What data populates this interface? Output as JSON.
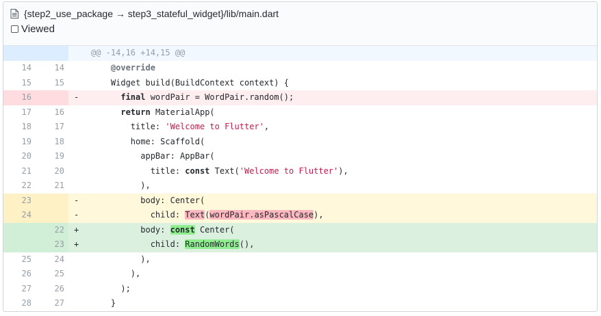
{
  "file_header": {
    "path": "{step2_use_package → step3_stateful_widget}/lib/main.dart",
    "viewed_label": "Viewed",
    "icon": "file-icon"
  },
  "hunk": {
    "header": "@@ -14,16 +14,15 @@"
  },
  "colors": {
    "deletion": "#ffeef0",
    "addition": "#e6ffed",
    "modified_old": "#fff8db",
    "modified_new": "#dbf0df",
    "string": "#c41a4c"
  },
  "lines": [
    {
      "old": "14",
      "new": "14",
      "sign": "",
      "parts": [
        [
          "    ",
          ""
        ],
        [
          "@override",
          "ann"
        ]
      ]
    },
    {
      "old": "15",
      "new": "15",
      "sign": "",
      "parts": [
        [
          "    Widget build(BuildContext context) {",
          ""
        ]
      ]
    },
    {
      "old": "16",
      "new": "",
      "sign": "-",
      "parts": [
        [
          "      ",
          ""
        ],
        [
          "final",
          "kw"
        ],
        [
          " wordPair = WordPair.random();",
          ""
        ]
      ]
    },
    {
      "old": "17",
      "new": "16",
      "sign": "",
      "parts": [
        [
          "      ",
          ""
        ],
        [
          "return",
          "kw"
        ],
        [
          " MaterialApp(",
          ""
        ]
      ]
    },
    {
      "old": "18",
      "new": "17",
      "sign": "",
      "parts": [
        [
          "        title: ",
          ""
        ],
        [
          "'Welcome to Flutter'",
          "str"
        ],
        [
          ",",
          ""
        ]
      ]
    },
    {
      "old": "19",
      "new": "18",
      "sign": "",
      "parts": [
        [
          "        home: Scaffold(",
          ""
        ]
      ]
    },
    {
      "old": "20",
      "new": "19",
      "sign": "",
      "parts": [
        [
          "          appBar: AppBar(",
          ""
        ]
      ]
    },
    {
      "old": "21",
      "new": "20",
      "sign": "",
      "parts": [
        [
          "            title: ",
          ""
        ],
        [
          "const",
          "kw"
        ],
        [
          " Text(",
          ""
        ],
        [
          "'Welcome to Flutter'",
          "str"
        ],
        [
          "),",
          ""
        ]
      ]
    },
    {
      "old": "22",
      "new": "21",
      "sign": "",
      "parts": [
        [
          "          ),",
          ""
        ]
      ]
    },
    {
      "old": "23",
      "new": "",
      "sign": "-",
      "parts": [
        [
          "          body: Center(",
          ""
        ]
      ]
    },
    {
      "old": "24",
      "new": "",
      "sign": "-",
      "parts": [
        [
          "            child: ",
          ""
        ],
        [
          "Text",
          "hl-del"
        ],
        [
          "(",
          ""
        ],
        [
          "wordPair.asPascalCase",
          "hl-del"
        ],
        [
          "),",
          ""
        ]
      ]
    },
    {
      "old": "",
      "new": "22",
      "sign": "+",
      "parts": [
        [
          "          body: ",
          ""
        ],
        [
          "const",
          "kw hl-add"
        ],
        [
          " Center(",
          ""
        ]
      ]
    },
    {
      "old": "",
      "new": "23",
      "sign": "+",
      "parts": [
        [
          "            child: ",
          ""
        ],
        [
          "RandomWords",
          "hl-add"
        ],
        [
          "(),",
          ""
        ]
      ]
    },
    {
      "old": "25",
      "new": "24",
      "sign": "",
      "parts": [
        [
          "          ),",
          ""
        ]
      ]
    },
    {
      "old": "26",
      "new": "25",
      "sign": "",
      "parts": [
        [
          "        ),",
          ""
        ]
      ]
    },
    {
      "old": "27",
      "new": "26",
      "sign": "",
      "parts": [
        [
          "      );",
          ""
        ]
      ]
    },
    {
      "old": "28",
      "new": "27",
      "sign": "",
      "parts": [
        [
          "    }",
          ""
        ]
      ]
    }
  ]
}
